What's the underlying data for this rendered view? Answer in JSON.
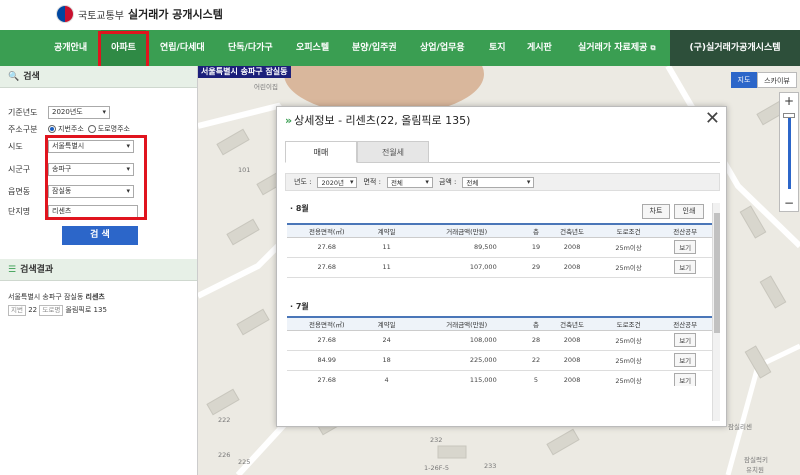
{
  "header": {
    "ministry": "국토교통부",
    "site_title": "실거래가 공개시스템"
  },
  "nav": {
    "items": [
      "공개안내",
      "아파트",
      "연립/다세대",
      "단독/다가구",
      "오피스텔",
      "분양/입주권",
      "상업/업무용",
      "토지",
      "게시판",
      "실거래가 자료제공"
    ],
    "active": "아파트",
    "right_label": "(구)실거래가공개시스템"
  },
  "search_panel": {
    "title": "검색",
    "base_year_label": "기준년도",
    "base_year_value": "2020년도",
    "address_type_label": "주소구분",
    "address_options": [
      "지번주소",
      "도로명주소"
    ],
    "selected_address": "지번주소",
    "sido_label": "시도",
    "sido_value": "서울특별시",
    "sigungu_label": "시군구",
    "sigungu_value": "송파구",
    "dong_label": "읍면동",
    "dong_value": "잠실동",
    "complex_label": "단지명",
    "complex_value": "리센츠",
    "search_button": "검 색"
  },
  "results_panel": {
    "title": "검색결과",
    "address_prefix": "서울특별시 송파구 잠실동",
    "complex_name": "리센츠",
    "jibun_tag": "지번",
    "jibun_value": "22",
    "road_tag": "도로명",
    "road_value": "올림픽로 135"
  },
  "map": {
    "location_text": "서울특별시 송파구 잠실동",
    "maptype_map": "지도",
    "maptype_skyview": "스카이뷰",
    "zoom_in": "+",
    "zoom_out": "−",
    "labels": [
      "어린이집",
      "232",
      "233",
      "1-26F-5",
      "잠실리센",
      "유치원",
      "잠실럭키",
      "101",
      "222",
      "225",
      "226"
    ]
  },
  "modal": {
    "title": "상세정보 - 리센츠(22, 올림픽로 135)",
    "close": "✕",
    "tabs": [
      "매매",
      "전월세"
    ],
    "active_tab": "매매",
    "filter_year_label": "년도 :",
    "filter_year_value": "2020년",
    "filter_area_label": "면적 :",
    "filter_area_value": "전체",
    "filter_price_label": "금액 :",
    "filter_price_value": "전체",
    "chart_button": "차트",
    "print_button": "인쇄",
    "columns": [
      "전용면적(㎡)",
      "계약일",
      "거래금액(만원)",
      "층",
      "건축년도",
      "도로조건",
      "전산공부"
    ],
    "months": [
      {
        "label": "· 8월",
        "rows": [
          [
            "27.68",
            "11",
            "89,500",
            "19",
            "2008",
            "25m이상",
            "보기"
          ],
          [
            "27.68",
            "11",
            "107,000",
            "29",
            "2008",
            "25m이상",
            "보기"
          ]
        ]
      },
      {
        "label": "· 7월",
        "rows": [
          [
            "27.68",
            "24",
            "108,000",
            "28",
            "2008",
            "25m이상",
            "보기"
          ],
          [
            "84.99",
            "18",
            "225,000",
            "22",
            "2008",
            "25m이상",
            "보기"
          ],
          [
            "27.68",
            "4",
            "115,000",
            "5",
            "2008",
            "25m이상",
            "보기"
          ]
        ]
      }
    ]
  },
  "colors": {
    "nav_green": "#3a9e52",
    "highlight_red": "#e0141e",
    "search_blue": "#2c66c9"
  }
}
